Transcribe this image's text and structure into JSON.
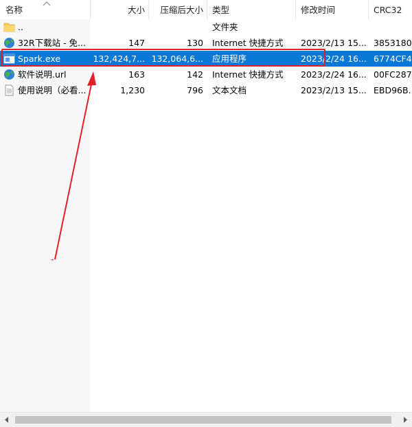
{
  "columns": {
    "name": "名称",
    "size": "大小",
    "packed": "压缩后大小",
    "type": "类型",
    "modified": "修改时间",
    "crc": "CRC32"
  },
  "rows": [
    {
      "icon": "folder-icon",
      "name": "..",
      "size": "",
      "packed": "",
      "type": "文件夹",
      "modified": "",
      "crc": ""
    },
    {
      "icon": "globe-icon",
      "name": "32R下载站 - 免...",
      "size": "147",
      "packed": "130",
      "type": "Internet 快捷方式",
      "modified": "2023/2/13 15...",
      "crc": "3853180"
    },
    {
      "icon": "exe-icon",
      "name": "Spark.exe",
      "size": "132,424,7...",
      "packed": "132,064,6...",
      "type": "应用程序",
      "modified": "2023/2/24 16...",
      "crc": "6774CF4"
    },
    {
      "icon": "globe-icon",
      "name": "软件说明.url",
      "size": "163",
      "packed": "142",
      "type": "Internet 快捷方式",
      "modified": "2023/2/24 16...",
      "crc": "00FC287"
    },
    {
      "icon": "text-file-icon",
      "name": "使用说明（必看...",
      "size": "1,230",
      "packed": "796",
      "type": "文本文档",
      "modified": "2023/2/13 15...",
      "crc": "EBD96B."
    }
  ],
  "annotation": {
    "mark": "-"
  },
  "colors": {
    "selection": "#0a78d7",
    "highlight": "#e0202a"
  }
}
